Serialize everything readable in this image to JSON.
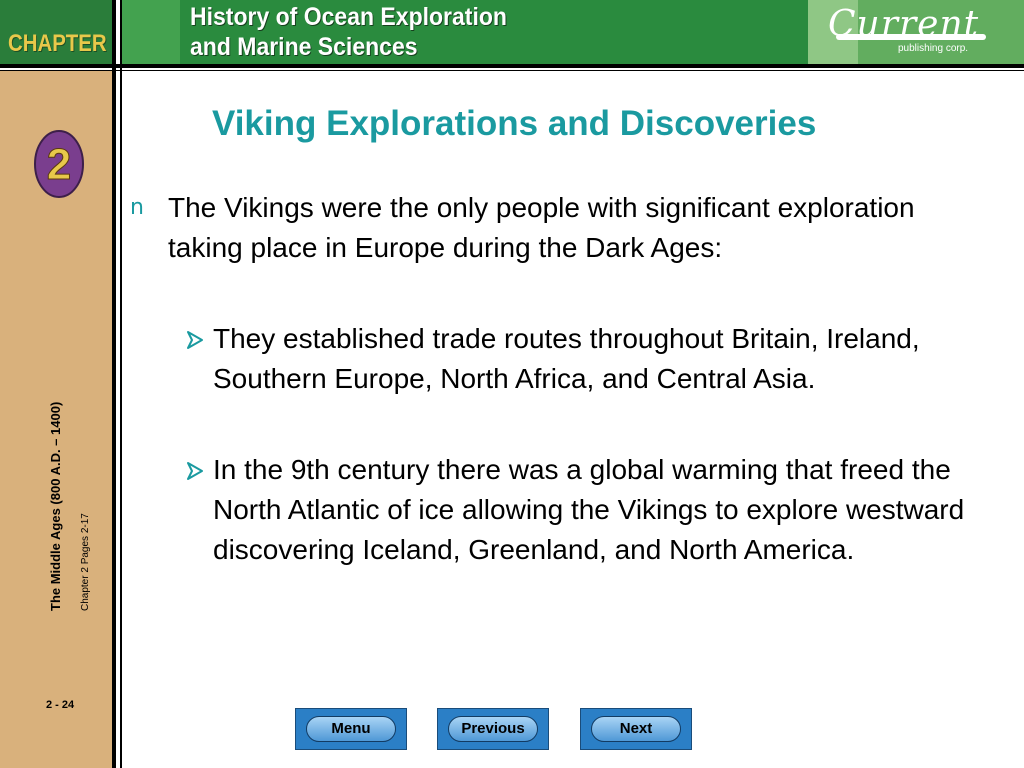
{
  "header": {
    "chapter_label": "CHAPTER",
    "chapter_number": "2",
    "title_line1": "History of Ocean Exploration",
    "title_line2": "and Marine Sciences",
    "logo_name": "Current",
    "logo_sub": "publishing corp."
  },
  "sidebar": {
    "unit_title": "The Middle Ages (800 A.D. – 1400)",
    "chapter_pages": "Chapter 2 Pages 2-17",
    "page_number": "2 - 24"
  },
  "slide": {
    "title": "Viking Explorations and Discoveries",
    "bullet_marker": "n",
    "bullet_text": "The Vikings were the only people with significant exploration taking place in Europe during the Dark Ages:",
    "sub_bullets": [
      "They established trade routes throughout Britain, Ireland, Southern Europe, North Africa, and Central Asia.",
      "In the 9th century there was a global warming that freed the North Atlantic of ice allowing the Vikings to explore westward discovering Iceland, Greenland, and North America."
    ]
  },
  "nav": {
    "menu_label": "Menu",
    "previous_label": "Previous",
    "next_label": "Next"
  },
  "colors": {
    "header_green": "#2a8b3e",
    "sidebar_tan": "#d9b17c",
    "title_teal": "#1a9aa0",
    "button_blue": "#2b7fc6"
  }
}
